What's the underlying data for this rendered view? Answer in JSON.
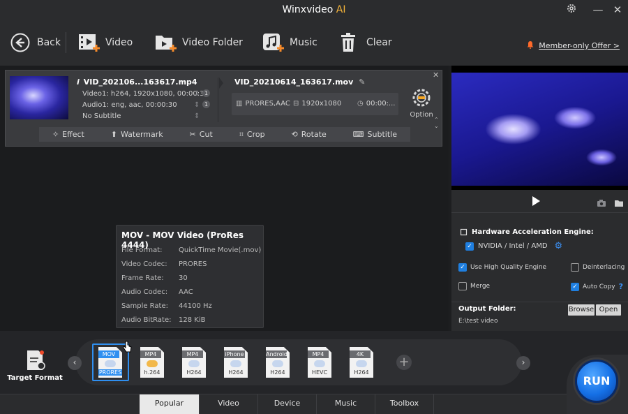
{
  "window": {
    "title": "Winxvideo",
    "title_ai": "AI",
    "controls": {
      "minimize": "—",
      "close": "✕"
    }
  },
  "toolbar": {
    "back": "Back",
    "video": "Video",
    "video_folder": "Video Folder",
    "music": "Music",
    "clear": "Clear",
    "offer": "Member-only Offer >"
  },
  "file": {
    "input_name": "VID_202106...163617.mp4",
    "video_info": "Video1: h264, 1920x1080, 00:00:30",
    "audio_info": "Audio1: eng, aac, 00:00:30",
    "subtitle_info": "No Subtitle",
    "video_count": "1",
    "audio_count": "1",
    "output_name": "VID_20210614_163617.mov",
    "output_codec": "PRORES,AAC",
    "output_res": "1920x1080",
    "output_time": "00:00:...",
    "option_label": "Option",
    "edit_tools": [
      "Effect",
      "Watermark",
      "Cut",
      "Crop",
      "Rotate",
      "Subtitle"
    ]
  },
  "tooltip": {
    "title": "MOV - MOV Video (ProRes 4444)",
    "rows": [
      {
        "k": "File Format:",
        "v": "QuickTime Movie(.mov)"
      },
      {
        "k": "Video Codec:",
        "v": "PRORES"
      },
      {
        "k": "Frame Rate:",
        "v": "30"
      },
      {
        "k": "Audio Codec:",
        "v": "AAC"
      },
      {
        "k": "Sample Rate:",
        "v": "44100 Hz"
      },
      {
        "k": "Audio BitRate:",
        "v": "128 KiB"
      }
    ]
  },
  "settings": {
    "hw_title": "Hardware Acceleration Engine:",
    "hw_option": "NVIDIA / Intel / AMD",
    "high_quality": "Use High Quality Engine",
    "deinterlacing": "Deinterlacing",
    "merge": "Merge",
    "auto_copy": "Auto Copy",
    "help": "?"
  },
  "output": {
    "label": "Output Folder:",
    "path": "E:\\test video",
    "browse": "Browse",
    "open": "Open"
  },
  "target_format": "Target Format",
  "formats": [
    {
      "tag": "MOV",
      "sub": "PRORES",
      "selected": true
    },
    {
      "tag": "MP4",
      "sub": "h.264"
    },
    {
      "tag": "MP4",
      "sub": "H264"
    },
    {
      "tag": "iPhone",
      "sub": "H264"
    },
    {
      "tag": "Android",
      "sub": "H264"
    },
    {
      "tag": "MP4",
      "sub": "HEVC"
    },
    {
      "tag": "4K",
      "sub": "H264"
    }
  ],
  "tabs": [
    "Popular",
    "Video",
    "Device",
    "Music",
    "Toolbox"
  ],
  "run_label": "RUN",
  "colors": {
    "accent": "#1f7fe0",
    "ai": "#f5b43a",
    "offer_bell": "#ff6a2a"
  }
}
